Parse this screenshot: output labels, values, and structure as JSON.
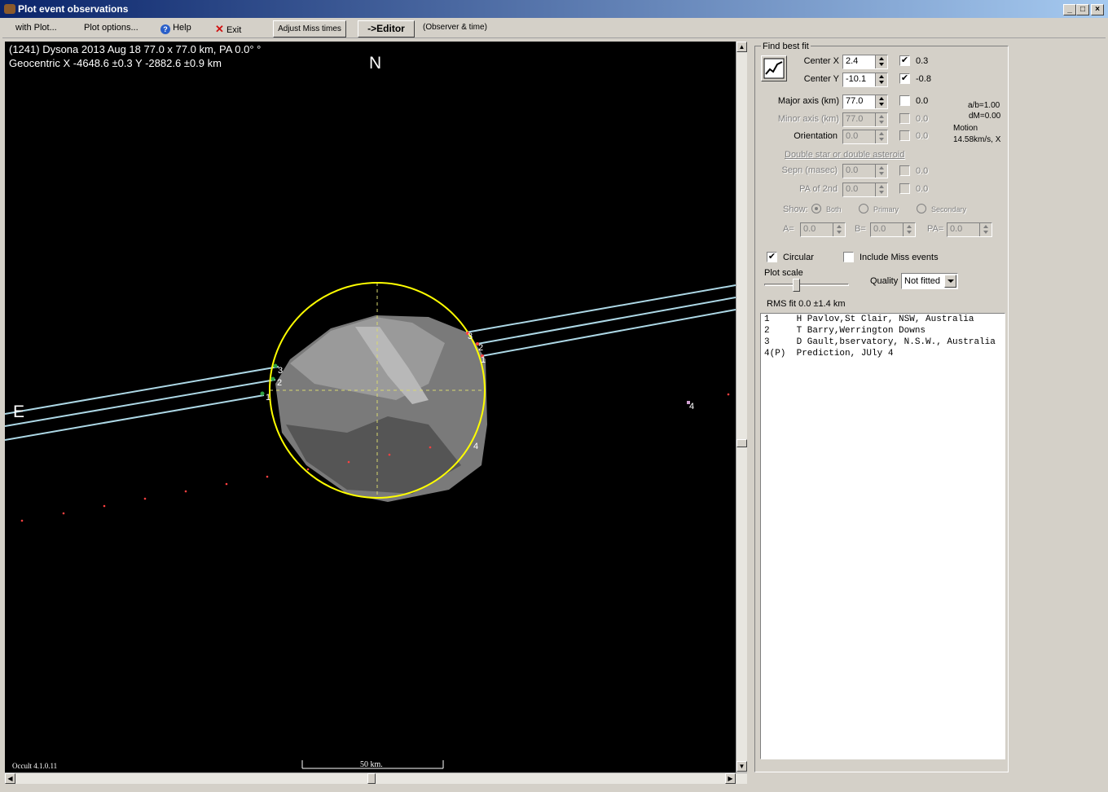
{
  "window": {
    "title": "Plot event observations"
  },
  "menu": {
    "with_plot": "with Plot...",
    "plot_options": "Plot options...",
    "help": "Help",
    "exit": "Exit",
    "adjust_miss": "Adjust Miss times",
    "editor": "->Editor",
    "observer_time": "(Observer & time)"
  },
  "plot": {
    "header_line1": "(1241) Dysona  2013 Aug 18  77.0 x 77.0 km, PA 0.0° °",
    "header_line2": "Geocentric X -4648.6 ±0.3  Y -2882.6 ±0.9 km",
    "north_label": "N",
    "east_label": "E",
    "version": "Occult 4.1.0.11",
    "scale_label": "50 km.",
    "chord_labels": [
      "1",
      "2",
      "3",
      "1",
      "2",
      "3",
      "4",
      "4"
    ]
  },
  "panel": {
    "find_best_fit": "Find best fit",
    "center_x_label": "Center X",
    "center_x_value": "2.4",
    "center_x_check": "0.3",
    "center_y_label": "Center Y",
    "center_y_value": "-10.1",
    "center_y_check": "-0.8",
    "major_axis_label": "Major axis (km)",
    "major_axis_value": "77.0",
    "major_axis_check": "0.0",
    "minor_axis_label": "Minor axis (km)",
    "minor_axis_value": "77.0",
    "minor_axis_check": "0.0",
    "orientation_label": "Orientation",
    "orientation_value": "0.0",
    "orientation_check": "0.0",
    "ab_ratio": "a/b=1.00",
    "dm": "dM=0.00",
    "motion_label": "Motion",
    "motion_value": "14.58km/s, X",
    "double_link": "Double star  or  double asteroid",
    "sepn_label": "Sepn (masec)",
    "sepn_value": "0.0",
    "sepn_check": "0.0",
    "pa2_label": "PA of 2nd",
    "pa2_value": "0.0",
    "pa2_check": "0.0",
    "show_label": "Show:",
    "show_both": "Both",
    "show_primary": "Primary",
    "show_secondary": "Secondary",
    "a_label": "A=",
    "a_value": "0.0",
    "b_label": "B=",
    "b_value": "0.0",
    "pa_label": "PA=",
    "pa_value": "0.0",
    "circular": "Circular",
    "include_miss": "Include Miss events",
    "plot_scale": "Plot scale",
    "quality_label": "Quality",
    "quality_value": "Not fitted",
    "rms": "RMS fit 0.0 ±1.4 km",
    "observers": [
      "1     H Pavlov,St Clair, NSW, Australia",
      "2     T Barry,Werrington Downs",
      "3     D Gault,bservatory, N.S.W., Australia",
      "4(P)  Prediction, JUly 4"
    ]
  },
  "colors": {
    "limb_fit": "#ffff00",
    "chords": "#add8e6",
    "prediction_dots": "#ff4040"
  }
}
